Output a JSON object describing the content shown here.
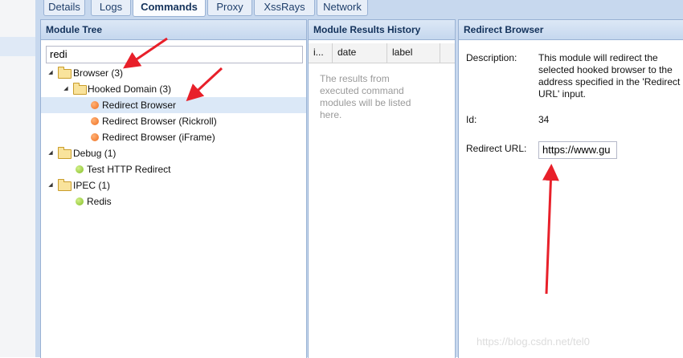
{
  "tabs": [
    "Details",
    "Logs",
    "Commands",
    "Proxy",
    "XssRays",
    "Network"
  ],
  "active_tab": "Commands",
  "module_tree": {
    "title": "Module Tree",
    "search_value": "redi",
    "nodes": [
      {
        "label": "Browser (3)",
        "type": "folder",
        "level": 0
      },
      {
        "label": "Hooked Domain (3)",
        "type": "folder",
        "level": 1
      },
      {
        "label": "Redirect Browser",
        "type": "module",
        "status": "orange",
        "level": 2,
        "selected": true
      },
      {
        "label": "Redirect Browser (Rickroll)",
        "type": "module",
        "status": "orange",
        "level": 2
      },
      {
        "label": "Redirect Browser (iFrame)",
        "type": "module",
        "status": "orange",
        "level": 2
      },
      {
        "label": "Debug (1)",
        "type": "folder",
        "level": 0
      },
      {
        "label": "Test HTTP Redirect",
        "type": "module",
        "status": "green",
        "level": 1
      },
      {
        "label": "IPEC (1)",
        "type": "folder",
        "level": 0
      },
      {
        "label": "Redis",
        "type": "module",
        "status": "green",
        "level": 1
      }
    ]
  },
  "results_history": {
    "title": "Module Results History",
    "columns": [
      "i...",
      "date",
      "label"
    ],
    "empty_text": "The results from executed command modules will be listed here."
  },
  "module_detail": {
    "title": "Redirect Browser",
    "description_label": "Description:",
    "description": "This module will redirect the selected hooked browser to the address specified in the 'Redirect URL' input.",
    "id_label": "Id:",
    "id_value": "34",
    "url_label": "Redirect URL:",
    "url_value": "https://www.gu"
  },
  "watermark": "https://blog.csdn.net/tel0",
  "colors": {
    "annotation_arrow": "#e8202a",
    "header_bg": "#c7d8ee",
    "selected_row": "#dbe8f7"
  }
}
